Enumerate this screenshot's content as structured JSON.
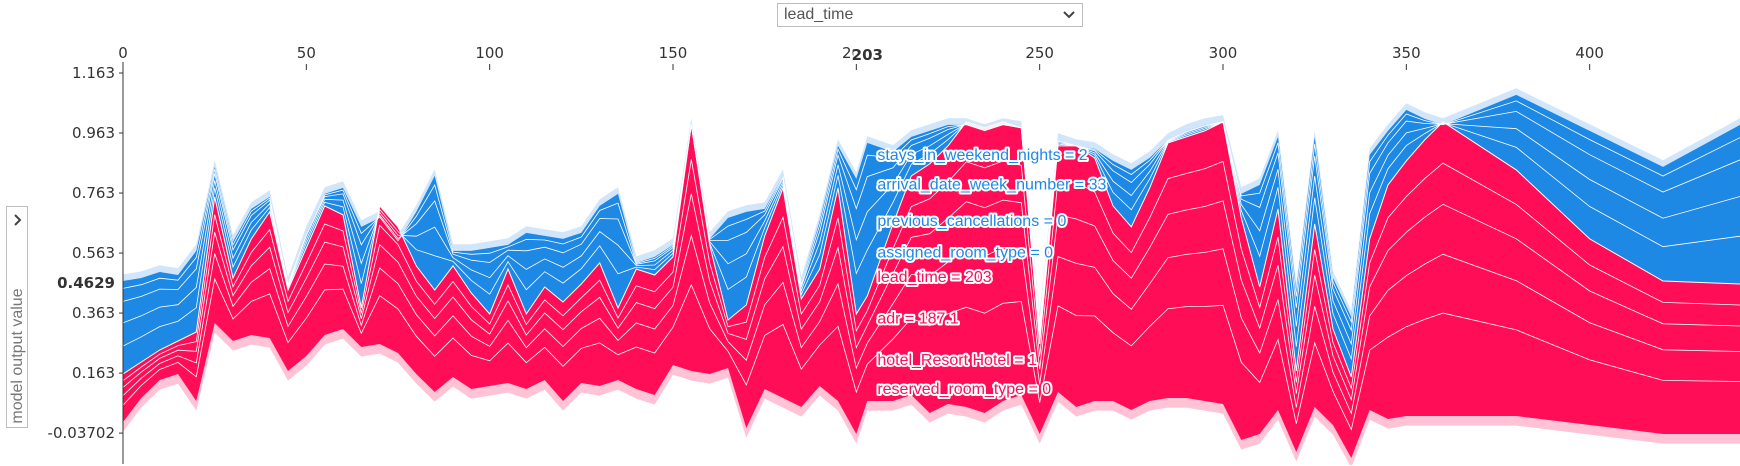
{
  "controls": {
    "x_feature": "lead_time",
    "y_label": "model output value"
  },
  "colors": {
    "positive": "#ff0d57",
    "positive_light": "#ffc3d5",
    "negative": "#1e88e5",
    "negative_light": "#d1e6fa",
    "edge": "#ffffff"
  },
  "chart_data": {
    "type": "area",
    "title": "",
    "xlabel": "lead_time",
    "ylabel": "model output value",
    "xlim": [
      0,
      441
    ],
    "ylim": [
      -0.14,
      1.163
    ],
    "x_ticks": [
      0,
      50,
      100,
      150,
      200,
      250,
      300,
      350,
      400
    ],
    "x_tick_labels": [
      "0",
      "50",
      "100",
      "150",
      "200",
      "250",
      "300",
      "350",
      "400"
    ],
    "y_ticks": [
      1.163,
      0.963,
      0.763,
      0.563,
      0.363,
      0.163,
      -0.03702
    ],
    "y_tick_labels": [
      "1.163",
      "0.963",
      "0.763",
      "0.563",
      "0.363",
      "0.163",
      "-0.03702"
    ],
    "highlight": {
      "x": 203,
      "x_label": "203",
      "y_label": "0.4629"
    },
    "bands": {
      "x": [
        0,
        5,
        10,
        15,
        20,
        25,
        30,
        35,
        40,
        45,
        50,
        55,
        60,
        65,
        70,
        75,
        80,
        85,
        90,
        95,
        100,
        105,
        110,
        115,
        120,
        125,
        130,
        135,
        140,
        145,
        150,
        155,
        160,
        165,
        170,
        175,
        180,
        185,
        190,
        195,
        200,
        203,
        210,
        215,
        220,
        225,
        230,
        235,
        240,
        245,
        250,
        255,
        260,
        265,
        270,
        275,
        280,
        285,
        290,
        295,
        300,
        305,
        310,
        315,
        320,
        325,
        330,
        335,
        340,
        345,
        350,
        355,
        360,
        380,
        400,
        420,
        441
      ],
      "top": [
        0.48,
        0.49,
        0.51,
        0.5,
        0.58,
        0.86,
        0.61,
        0.72,
        0.76,
        0.47,
        0.64,
        0.77,
        0.79,
        0.66,
        0.69,
        0.61,
        0.71,
        0.83,
        0.58,
        0.58,
        0.59,
        0.6,
        0.64,
        0.63,
        0.62,
        0.64,
        0.73,
        0.77,
        0.54,
        0.56,
        0.6,
        1.0,
        0.62,
        0.69,
        0.71,
        0.72,
        0.83,
        0.47,
        0.68,
        0.93,
        0.82,
        0.94,
        0.91,
        0.96,
        0.98,
        1.0,
        1.0,
        0.98,
        1.0,
        0.99,
        0.35,
        0.95,
        0.93,
        0.92,
        0.88,
        0.85,
        0.89,
        0.95,
        0.98,
        1.0,
        1.01,
        0.77,
        0.8,
        0.96,
        0.45,
        0.96,
        0.49,
        0.36,
        0.9,
        0.98,
        1.05,
        1.02,
        1.0,
        1.1,
        0.98,
        0.86,
        1.0
      ],
      "mid": [
        0.16,
        0.2,
        0.24,
        0.27,
        0.3,
        0.75,
        0.48,
        0.61,
        0.7,
        0.44,
        0.58,
        0.72,
        0.69,
        0.38,
        0.72,
        0.65,
        0.52,
        0.44,
        0.52,
        0.43,
        0.36,
        0.51,
        0.36,
        0.45,
        0.4,
        0.46,
        0.53,
        0.38,
        0.51,
        0.49,
        0.55,
        0.99,
        0.59,
        0.34,
        0.39,
        0.62,
        0.78,
        0.41,
        0.51,
        0.78,
        0.36,
        0.42,
        0.66,
        0.82,
        0.86,
        0.92,
        1.0,
        0.98,
        1.0,
        0.98,
        0.26,
        0.92,
        0.92,
        0.88,
        0.72,
        0.65,
        0.78,
        0.93,
        0.95,
        0.97,
        1.0,
        0.68,
        0.45,
        0.71,
        0.17,
        0.66,
        0.31,
        0.15,
        0.61,
        0.79,
        0.87,
        0.94,
        1.0,
        0.84,
        0.61,
        0.47,
        0.46
      ],
      "bottom": [
        -0.02,
        0.06,
        0.12,
        0.14,
        0.05,
        0.31,
        0.25,
        0.27,
        0.26,
        0.15,
        0.2,
        0.27,
        0.29,
        0.23,
        0.24,
        0.21,
        0.14,
        0.08,
        0.13,
        0.09,
        0.1,
        0.11,
        0.09,
        0.12,
        0.05,
        0.11,
        0.1,
        0.12,
        0.09,
        0.07,
        0.17,
        0.15,
        0.14,
        0.16,
        -0.04,
        0.09,
        0.06,
        0.03,
        0.1,
        0.05,
        -0.06,
        0.05,
        0.05,
        0.07,
        0.01,
        0.04,
        0.03,
        0.01,
        0.05,
        0.07,
        -0.06,
        0.08,
        0.03,
        0.05,
        0.05,
        0.02,
        0.05,
        0.06,
        0.06,
        0.05,
        0.04,
        -0.08,
        -0.06,
        0.02,
        -0.12,
        0.03,
        -0.03,
        -0.14,
        0.02,
        -0.01,
        0.0,
        0.0,
        0.0,
        0.0,
        -0.03,
        -0.06,
        -0.06
      ],
      "pos_lines": [
        0.35,
        0.55,
        0.72,
        0.86
      ],
      "neg_lines": [
        0.3,
        0.55,
        0.78,
        0.92
      ]
    },
    "feature_labels": [
      {
        "text": "stays_in_weekend_nights = 2",
        "effect": "negative",
        "pos": 0.0
      },
      {
        "text": "arrival_date_week_number = 33",
        "effect": "negative",
        "pos": 0.12
      },
      {
        "text": "previous_cancellations = 0",
        "effect": "negative",
        "pos": 0.27
      },
      {
        "text": "assigned_room_type = 0",
        "effect": "negative",
        "pos": 0.4
      },
      {
        "text": "lead_time = 203",
        "effect": "positive",
        "pos": 0.5
      },
      {
        "text": "adr = 187.1",
        "effect": "positive",
        "pos": 0.67
      },
      {
        "text": "hotel_Resort Hotel = 1",
        "effect": "positive",
        "pos": 0.84
      },
      {
        "text": "reserved_room_type = 0",
        "effect": "positive",
        "pos": 0.96
      }
    ]
  }
}
